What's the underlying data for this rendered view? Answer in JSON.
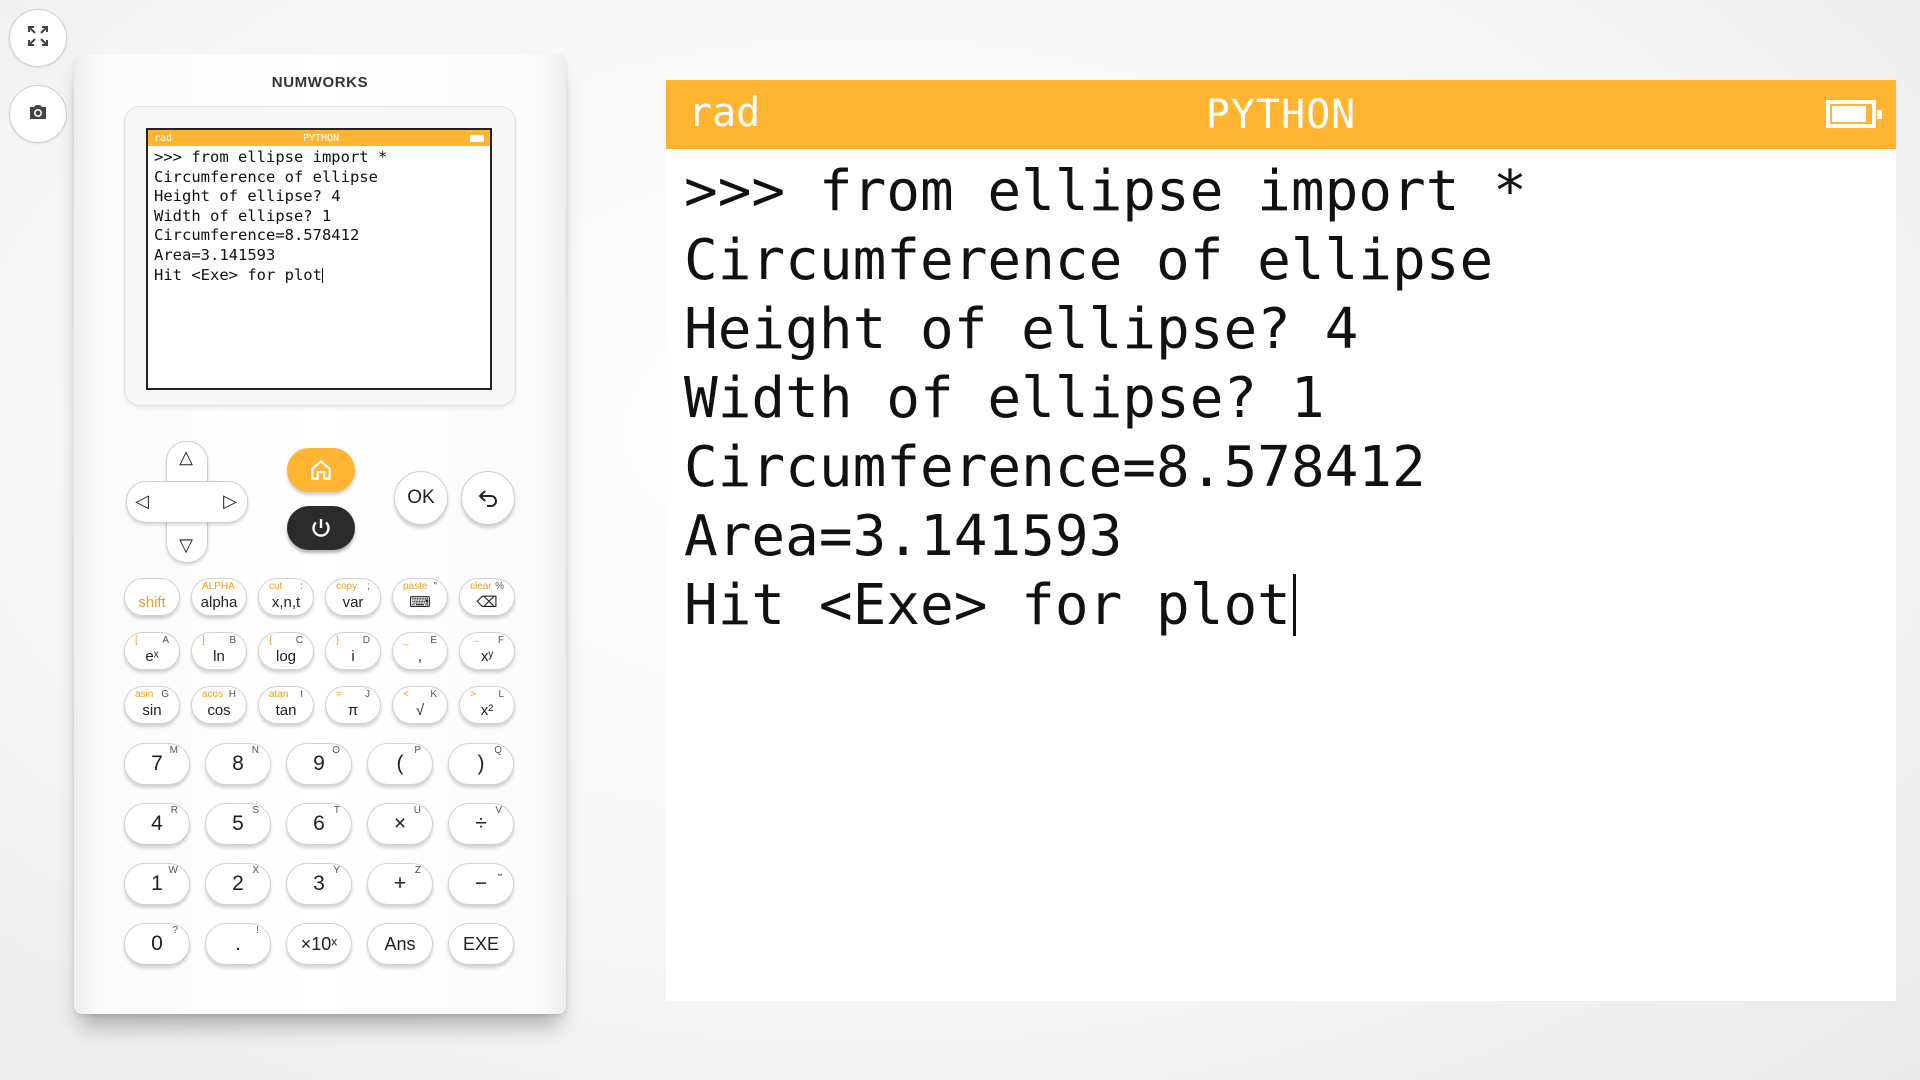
{
  "toolbar": {
    "fullscreen_icon": "fullscreen-icon",
    "screenshot_icon": "camera-icon"
  },
  "calculator": {
    "brand": "NUMWORKS",
    "screen": {
      "mode": "rad",
      "title": "PYTHON",
      "lines": [
        ">>> from ellipse import *",
        "Circumference of ellipse",
        "Height of ellipse? 4",
        "Width of ellipse? 1",
        "Circumference=8.578412",
        "Area=3.141593",
        "Hit <Exe> for plot"
      ]
    },
    "nav": {
      "ok_label": "OK"
    },
    "function_keys": [
      {
        "main": "shift",
        "tl": "",
        "tr": ""
      },
      {
        "main": "alpha",
        "tl": "ALPHA",
        "tr": ""
      },
      {
        "main": "x,n,t",
        "tl": "cut",
        "tr": ":"
      },
      {
        "main": "var",
        "tl": "copy",
        "tr": ";"
      },
      {
        "main": "⌨",
        "tl": "paste",
        "tr": "\""
      },
      {
        "main": "⌫",
        "tl": "clear",
        "tr": "%"
      },
      {
        "main": "eˣ",
        "tl": "[",
        "tr": "A"
      },
      {
        "main": "ln",
        "tl": "]",
        "tr": "B"
      },
      {
        "main": "log",
        "tl": "{",
        "tr": "C"
      },
      {
        "main": "i",
        "tl": "}",
        "tr": "D"
      },
      {
        "main": ",",
        "tl": "_",
        "tr": "E"
      },
      {
        "main": "xʸ",
        "tl": "→",
        "tr": "F"
      },
      {
        "main": "sin",
        "tl": "asin",
        "tr": "G"
      },
      {
        "main": "cos",
        "tl": "acos",
        "tr": "H"
      },
      {
        "main": "tan",
        "tl": "atan",
        "tr": "I"
      },
      {
        "main": "π",
        "tl": "=",
        "tr": "J"
      },
      {
        "main": "√",
        "tl": "<",
        "tr": "K"
      },
      {
        "main": "x²",
        "tl": ">",
        "tr": "L"
      }
    ],
    "number_keys": [
      {
        "main": "7",
        "tr": "M"
      },
      {
        "main": "8",
        "tr": "N"
      },
      {
        "main": "9",
        "tr": "O"
      },
      {
        "main": "(",
        "tr": "P"
      },
      {
        "main": ")",
        "tr": "Q"
      },
      {
        "main": "4",
        "tr": "R"
      },
      {
        "main": "5",
        "tr": "S"
      },
      {
        "main": "6",
        "tr": "T"
      },
      {
        "main": "×",
        "tr": "U"
      },
      {
        "main": "÷",
        "tr": "V"
      },
      {
        "main": "1",
        "tr": "W"
      },
      {
        "main": "2",
        "tr": "X"
      },
      {
        "main": "3",
        "tr": "Y"
      },
      {
        "main": "+",
        "tr": "Z"
      },
      {
        "main": "−",
        "tr": "⎵"
      },
      {
        "main": "0",
        "tr": "?"
      },
      {
        "main": ".",
        "tr": "!"
      },
      {
        "main": "×10ˣ",
        "tr": ""
      },
      {
        "main": "Ans",
        "tr": ""
      },
      {
        "main": "EXE",
        "tr": ""
      }
    ]
  },
  "display": {
    "mode": "rad",
    "title": "PYTHON",
    "lines": [
      ">>> from ellipse import *",
      "Circumference of ellipse",
      "Height of ellipse? 4",
      "Width of ellipse? 1",
      "Circumference=8.578412",
      "Area=3.141593",
      "Hit <Exe> for plot"
    ]
  },
  "colors": {
    "accent": "#ffb531",
    "power": "#2b2b2b"
  }
}
